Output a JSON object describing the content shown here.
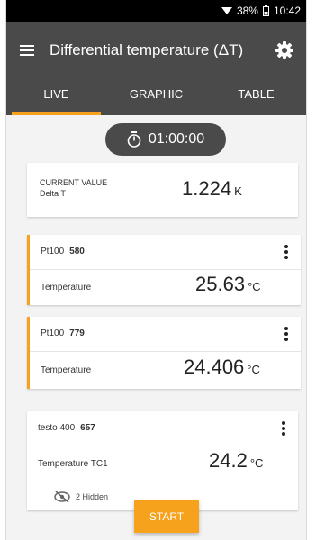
{
  "status": {
    "battery": "38%",
    "time": "10:42"
  },
  "header": {
    "title": "Differential temperature (ΔT)",
    "menu_icon": "menu-icon",
    "settings_icon": "gear-icon"
  },
  "tabs": [
    {
      "label": "LIVE",
      "active": true
    },
    {
      "label": "GRAPHIC",
      "active": false
    },
    {
      "label": "TABLE",
      "active": false
    }
  ],
  "timer": {
    "value": "01:00:00",
    "icon": "stopwatch-icon"
  },
  "current_value": {
    "label": "CURRENT VALUE",
    "sublabel": "Delta T",
    "value": "1.224",
    "unit": "K"
  },
  "sensors": [
    {
      "type": "Pt100",
      "id": "580",
      "measure": "Temperature",
      "value": "25.63",
      "unit": "°C"
    },
    {
      "type": "Pt100",
      "id": "779",
      "measure": "Temperature",
      "value": "24.406",
      "unit": "°C"
    },
    {
      "type": "testo 400",
      "id": "657",
      "measure": "Temperature TC1",
      "value": "24.2",
      "unit": "°C",
      "hidden": "2 Hidden"
    }
  ],
  "actions": {
    "start": "START"
  },
  "colors": {
    "accent": "#f6a21d",
    "appbar": "#4a4a4a"
  }
}
